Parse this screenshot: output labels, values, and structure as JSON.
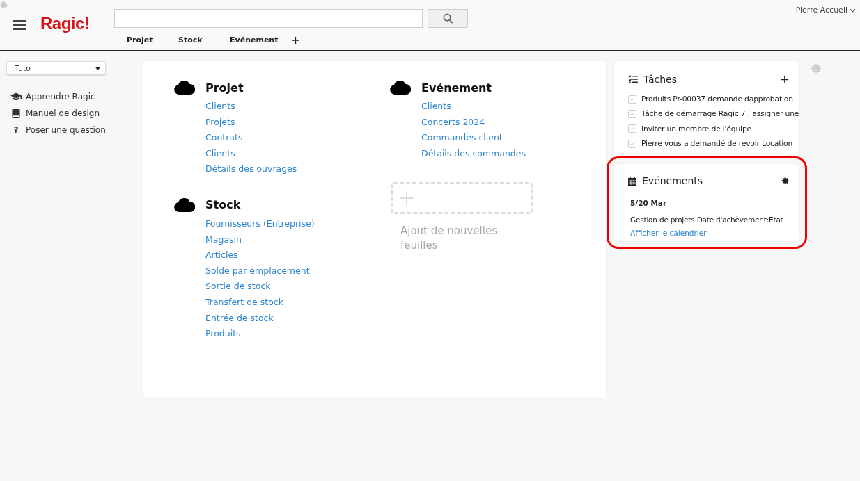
{
  "header": {
    "logo": "Ragic!",
    "user": "Pierre Accueil",
    "tabs": [
      {
        "label": "Projet"
      },
      {
        "label": "Stock"
      },
      {
        "label": "Evénement"
      }
    ],
    "add_tab": "+"
  },
  "sidebar": {
    "dropdown": "Tuto",
    "items": [
      {
        "kind": "learn",
        "label": "Apprendre Ragic"
      },
      {
        "kind": "manual",
        "label": "Manuel de design"
      },
      {
        "kind": "question",
        "icon": "?",
        "label": "Poser une question"
      }
    ]
  },
  "modules": [
    {
      "title": "Projet",
      "sheets": [
        "Clients",
        "Projets",
        "Contrats",
        "Clients",
        "Détails des ouvrages"
      ]
    },
    {
      "title": "Evénement",
      "sheets": [
        "Clients",
        "Concerts 2024",
        "Commandes client",
        "Détails des commandes"
      ]
    },
    {
      "title": "Stock",
      "sheets": [
        "Fournisseurs (Entreprise)",
        "Magasin",
        "Articles",
        "Solde par emplacement",
        "Sortie de stock",
        "Transfert de stock",
        "Entrée de stock",
        "Produits"
      ]
    }
  ],
  "add_sheets": "Ajout de nouvelles feuilles",
  "tasks": {
    "title": "Tâches",
    "add": "+",
    "items": [
      {
        "label": "Produits Pr-00037 demande dapprobation",
        "checked": false
      },
      {
        "label": "Tâche de démarrage Ragic 7 : assigner une",
        "checked": false
      },
      {
        "label": "Inviter un membre de l'équipe",
        "checked": false
      },
      {
        "label": "Pierre vous a demandé de revoir Location",
        "checked": false
      }
    ]
  },
  "events": {
    "title": "Evénements",
    "highlighted": true,
    "date": "5/20 Mar",
    "entry": "Gestion de projets Date d'achèvement:Etat",
    "link": "Afficher le calendrier"
  }
}
